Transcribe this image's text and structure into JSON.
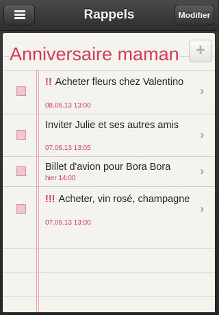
{
  "navbar": {
    "title": "Rappels",
    "edit_label": "Modifier",
    "menu_icon": "hamburger-icon"
  },
  "list": {
    "title": "Anniversaire maman",
    "add_label": "+",
    "accent_color": "#d33a55"
  },
  "tasks": [
    {
      "priority": "!!",
      "title": "Acheter fleurs chez Valentino",
      "date": "08.06.13 13:00"
    },
    {
      "priority": "",
      "title": "Inviter Julie et ses autres amis",
      "date": "07.06.13 13:05"
    },
    {
      "priority": "",
      "title": "Billet d'avion pour Bora Bora",
      "date": "hier 14:00"
    },
    {
      "priority": "!!!",
      "title": "Acheter, vin rosé, champagne",
      "date": "07.06.13 13:00"
    }
  ],
  "icons": {
    "chevron": "›"
  }
}
